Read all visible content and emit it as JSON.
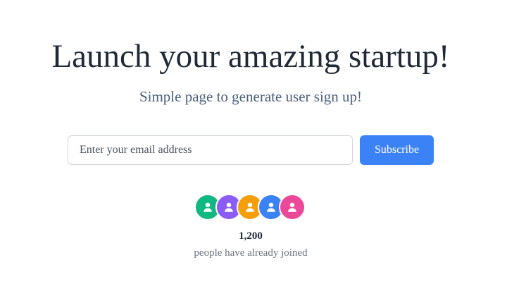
{
  "hero": {
    "headline": "Launch your amazing startup!",
    "subheadline": "Simple page to generate user sign up!"
  },
  "signup": {
    "email_placeholder": "Enter your email address",
    "email_value": "",
    "subscribe_label": "Subscribe"
  },
  "social_proof": {
    "avatars": [
      {
        "icon": "user-icon",
        "color": "#10b981"
      },
      {
        "icon": "user-icon",
        "color": "#8b5cf6"
      },
      {
        "icon": "user-icon",
        "color": "#f59e0b"
      },
      {
        "icon": "user-icon",
        "color": "#3b82f6"
      },
      {
        "icon": "user-icon",
        "color": "#ec4899"
      }
    ],
    "count": "1,200",
    "caption": "people have already joined"
  },
  "theme": {
    "accent": "#3b82f6",
    "heading_color": "#1f2937",
    "subheading_color": "#4b5f7c"
  }
}
